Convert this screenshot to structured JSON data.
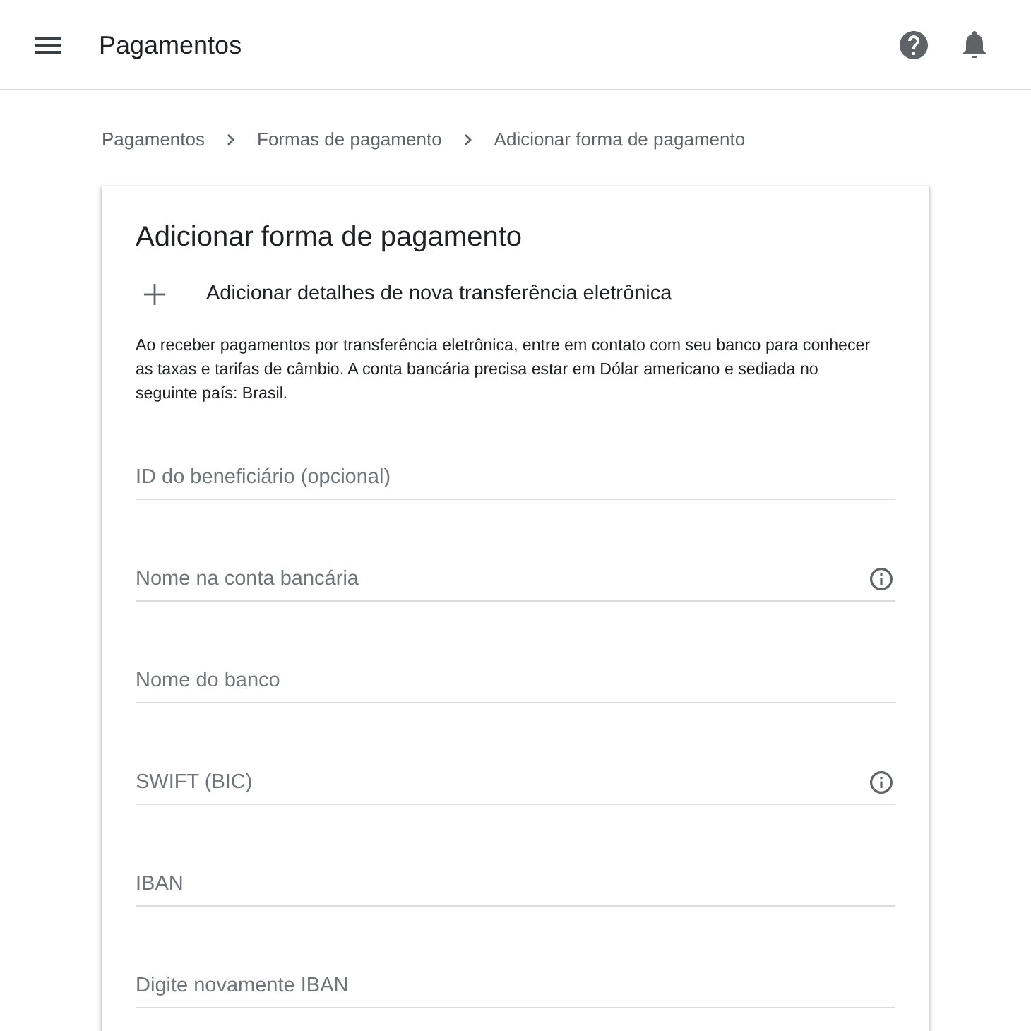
{
  "header": {
    "title": "Pagamentos"
  },
  "breadcrumb": [
    {
      "label": "Pagamentos"
    },
    {
      "label": "Formas de pagamento"
    },
    {
      "label": "Adicionar forma de pagamento"
    }
  ],
  "card": {
    "title": "Adicionar forma de pagamento",
    "add_action": {
      "label": "Adicionar detalhes de nova transferência eletrônica"
    },
    "notice": "Ao receber pagamentos por transferência eletrônica, entre em contato com seu banco para conhecer as taxas e tarifas de câmbio. A conta bancária precisa estar em Dólar americano e sediada no seguinte país: Brasil.",
    "fields": [
      {
        "placeholder": "ID do beneficiário (opcional)",
        "info": false
      },
      {
        "placeholder": "Nome na conta bancária",
        "info": true
      },
      {
        "placeholder": "Nome do banco",
        "info": false
      },
      {
        "placeholder": "SWIFT (BIC)",
        "info": true
      },
      {
        "placeholder": "IBAN",
        "info": false
      },
      {
        "placeholder": "Digite novamente IBAN",
        "info": false
      }
    ]
  }
}
